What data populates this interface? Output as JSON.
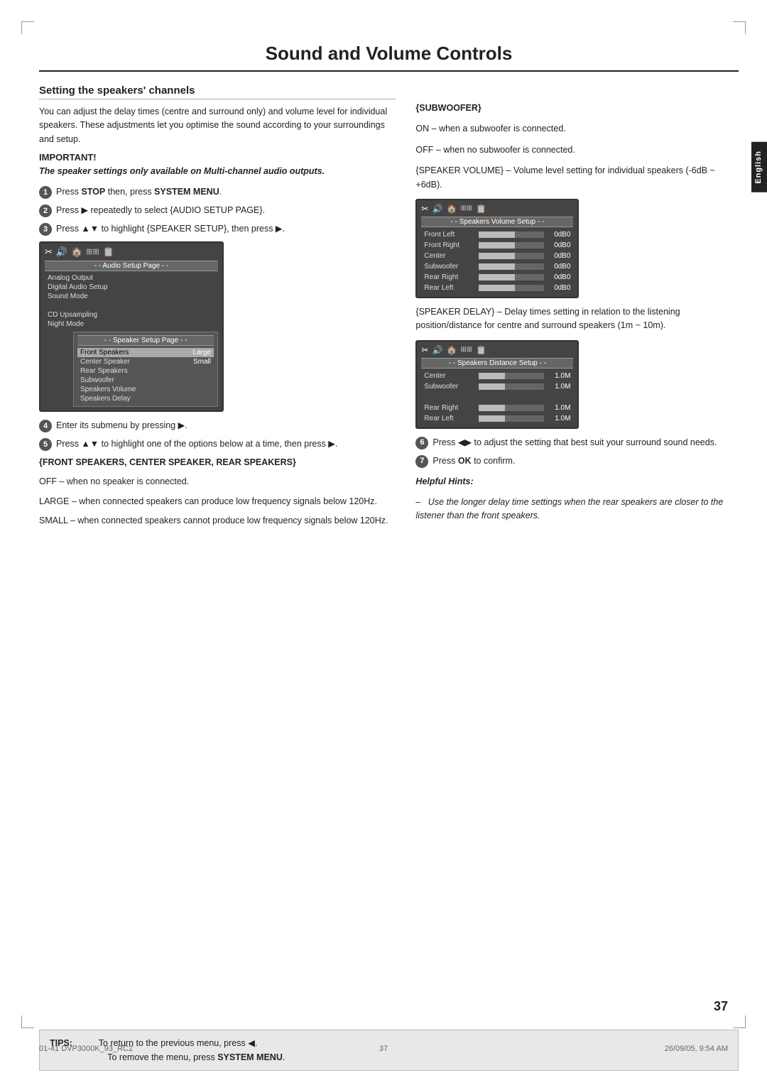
{
  "page": {
    "title": "Sound and Volume Controls",
    "number": "37",
    "footer_left": "01-41 DVP3000K_93_RC2",
    "footer_center": "37",
    "footer_right": "26/09/05, 9:54 AM"
  },
  "english_tab": "English",
  "section": {
    "heading": "Setting the speakers' channels",
    "intro": "You can adjust the delay times (centre and surround only) and volume level for individual speakers. These adjustments let you optimise the sound according to your surroundings and setup.",
    "important_label": "IMPORTANT!",
    "important_italic": "The speaker settings only available on Multi-channel audio outputs.",
    "steps": [
      {
        "num": "1",
        "text_parts": [
          "Press ",
          "STOP",
          " then, press ",
          "SYSTEM MENU",
          "."
        ]
      },
      {
        "num": "2",
        "text_parts": [
          "Press ▶ repeatedly to select {AUDIO SETUP PAGE}."
        ]
      },
      {
        "num": "3",
        "text_parts": [
          "Press ▲▼ to highlight {SPEAKER SETUP}, then press ▶."
        ]
      },
      {
        "num": "4",
        "text_parts": [
          "Enter its submenu by pressing ▶."
        ]
      },
      {
        "num": "5",
        "text_parts": [
          "Press ▲▼ to highlight one of the options below at a time, then press ▶."
        ]
      }
    ],
    "speaker_types_heading": "{FRONT SPEAKERS, CENTER SPEAKER, REAR SPEAKERS}",
    "speaker_types_lines": [
      "OFF – when no speaker is connected.",
      "LARGE – when connected speakers can produce low frequency signals below 120Hz.",
      "SMALL – when connected speakers cannot produce low frequency signals below 120Hz."
    ]
  },
  "right": {
    "subwoofer_heading": "{SUBWOOFER}",
    "subwoofer_lines": [
      "ON – when a subwoofer is connected.",
      "OFF – when no subwoofer is connected."
    ],
    "speaker_volume_text": "{SPEAKER VOLUME} – Volume level setting for individual speakers (-6dB ~ +6dB).",
    "speaker_delay_text": "{SPEAKER DELAY} – Delay times setting in relation to the listening position/distance for centre and surround speakers (1m ~ 10m).",
    "steps_right": [
      {
        "num": "6",
        "text_parts": [
          "Press ◀▶ to adjust the setting that best suit your surround sound needs."
        ]
      },
      {
        "num": "7",
        "text_parts": [
          "Press ",
          "OK",
          " to confirm."
        ]
      }
    ],
    "helpful_hints_label": "Helpful Hints:",
    "helpful_hints_text": "–   Use the longer delay time settings when the rear speakers are closer to the listener than the front speakers."
  },
  "screen_audio": {
    "title": "- - Audio Setup Page - -",
    "icons": [
      "✂",
      "◀◀",
      "🏠",
      "###",
      "📋"
    ],
    "rows": [
      {
        "label": "Analog Output",
        "highlighted": false
      },
      {
        "label": "Digital Audio Setup",
        "highlighted": false
      },
      {
        "label": "Sound Mode",
        "highlighted": false
      },
      {
        "label": "",
        "highlighted": false
      },
      {
        "label": "CD Upsampling",
        "highlighted": false
      },
      {
        "label": "Night Mode",
        "highlighted": false
      }
    ]
  },
  "screen_speaker": {
    "title": "- - Speaker Setup Page - -",
    "rows": [
      {
        "label": "Front Speakers",
        "value": "Large",
        "highlighted": true
      },
      {
        "label": "Center Speaker",
        "value": "Small",
        "highlighted": false
      },
      {
        "label": "Rear Speakers",
        "value": "",
        "highlighted": false
      },
      {
        "label": "Subwoofer",
        "value": "",
        "highlighted": false
      },
      {
        "label": "Speakers Volume",
        "value": "",
        "highlighted": false
      },
      {
        "label": "Speakers Delay",
        "value": "",
        "highlighted": false
      }
    ]
  },
  "screen_volume": {
    "title": "- - Speakers Volume Setup - -",
    "rows": [
      {
        "label": "Front Left",
        "bar": 55,
        "value": "0dB0"
      },
      {
        "label": "Front Right",
        "bar": 55,
        "value": "0dB0"
      },
      {
        "label": "Center",
        "bar": 55,
        "value": "0dB0"
      },
      {
        "label": "Subwoofer",
        "bar": 55,
        "value": "0dB0"
      },
      {
        "label": "Rear Right",
        "bar": 55,
        "value": "0dB0"
      },
      {
        "label": "Rear Left",
        "bar": 55,
        "value": "0dB0"
      }
    ]
  },
  "screen_distance": {
    "title": "- - Speakers Distance Setup - -",
    "rows": [
      {
        "label": "Center",
        "bar": 40,
        "value": "1.0M"
      },
      {
        "label": "Subwoofer",
        "bar": 40,
        "value": "1.0M"
      },
      {
        "label": "",
        "bar": 0,
        "value": ""
      },
      {
        "label": "Rear Right",
        "bar": 40,
        "value": "1.0M"
      },
      {
        "label": "Rear Left",
        "bar": 40,
        "value": "1.0M"
      }
    ]
  },
  "tips": {
    "label": "TIPS:",
    "line1": "To return to the previous menu, press ◀.",
    "line2": "To remove the menu, press SYSTEM MENU."
  }
}
